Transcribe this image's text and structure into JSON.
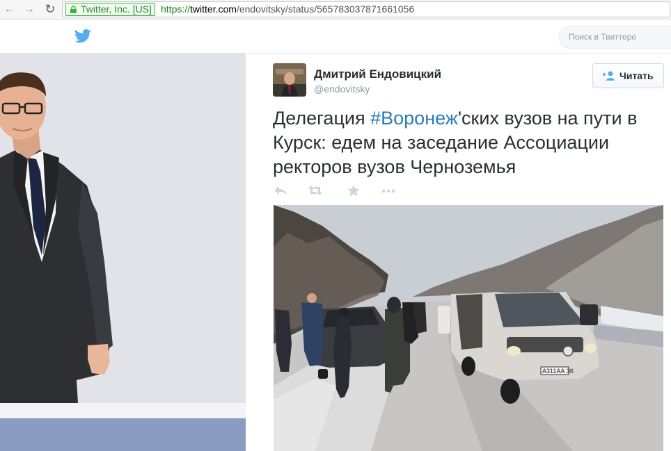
{
  "browser": {
    "back_icon": "arrow-left-icon",
    "forward_icon": "arrow-right-icon",
    "reload_icon": "reload-icon",
    "ev_label": "Twitter, Inc. [US]",
    "url_scheme": "https://",
    "url_host": "twitter.com",
    "url_path": "/endovitsky/status/565783037871661056"
  },
  "topbar": {
    "logo_icon": "twitter-bird-icon",
    "search_placeholder": "Поиск в Твиттере"
  },
  "tweet": {
    "author_name": "Дмитрий Ендовицкий",
    "author_handle": "@endovitsky",
    "follow_label": "Читать",
    "text_before": "Делегация ",
    "hashtag": "#Воронеж",
    "text_after": "'ских вузов на пути в Курск: едем на заседание Ассоциации ректоров вузов Черноземья",
    "actions": [
      "reply-icon",
      "retweet-icon",
      "favorite-icon",
      "more-icon"
    ],
    "plate_text": "А311АА 36"
  },
  "colors": {
    "hashtag": "#2b7bb9",
    "twitter_blue": "#55acee",
    "left_panel": "#e2e3e9",
    "left_band": "#8a9cc2"
  }
}
